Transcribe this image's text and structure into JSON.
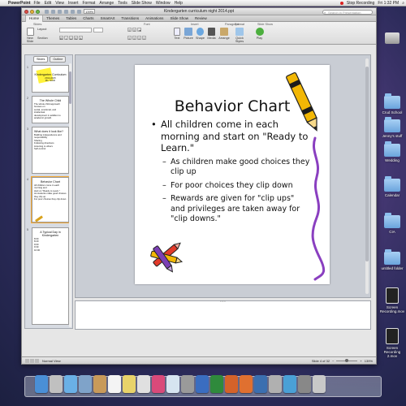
{
  "menubar": {
    "app_name": "PowerPoint",
    "items": [
      "File",
      "Edit",
      "View",
      "Insert",
      "Format",
      "Arrange",
      "Tools",
      "Slide Show",
      "Window",
      "Help"
    ],
    "recording_label": "Stop Recording",
    "clock": "Fri 1:32 PM"
  },
  "window": {
    "title": "Kindergarten curriculum night 2014.ppt",
    "zoom": "139%",
    "search_placeholder": "Search in Presentation"
  },
  "ribbon": {
    "tabs": [
      "Home",
      "Themes",
      "Tables",
      "Charts",
      "SmartArt",
      "Transitions",
      "Animations",
      "Slide Show",
      "Review"
    ],
    "active_tab": "Home",
    "groups": [
      "Slides",
      "Font",
      "Paragraph",
      "Insert",
      "Format",
      "Slide Show"
    ],
    "slides_buttons": [
      "New Slide",
      "Layout",
      "Section"
    ],
    "insert_buttons": [
      "Text",
      "Picture",
      "Shape",
      "Media",
      "Arrange",
      "Quick Styles",
      "Play"
    ]
  },
  "pane": {
    "tabs": [
      "Slides",
      "Outline"
    ],
    "thumbnails": [
      {
        "num": "1",
        "title": "Kindergarten Curriculum",
        "lines": [
          "2014-2015",
          "Ms. Smith"
        ]
      },
      {
        "num": "2",
        "title": "The Whole Child",
        "lines": [
          "The whole child approach focuses on",
          "social, emotional, and intellectual",
          "development in addition to academic growth."
        ]
      },
      {
        "num": "3",
        "title": "What does it look like?",
        "lines": [
          "Building independence and responsibility",
          "Sharing",
          "Following directions",
          "Listening to others",
          "Self-control"
        ]
      },
      {
        "num": "4",
        "title": "Behavior Chart",
        "lines": [
          "All children come in each morning and",
          "start on \"Ready to Learn.\"",
          "As students make good choices they clip up",
          "For poor choices they clip down"
        ]
      },
      {
        "num": "5",
        "title": "A Typical Day in Kindergarten",
        "lines": [
          "8:00",
          "8:20",
          "9:00",
          "9:30",
          "10:00"
        ]
      }
    ]
  },
  "slide": {
    "title": "Behavior Chart",
    "bullet": "All children come in each morning and start on \"Ready to Learn.\"",
    "subbullets": [
      "As children make good choices they clip up",
      "For poor choices they clip down",
      "Rewards are given for \"clip ups\" and privileges are taken away for \"clip downs.\""
    ]
  },
  "statusbar": {
    "view": "Normal View",
    "slide_position": "Slide 4 of 32",
    "zoom": "139%"
  },
  "desktop": {
    "icons": [
      {
        "label": "Crud School"
      },
      {
        "label": "Jenny's stuff"
      },
      {
        "label": "Wedding"
      },
      {
        "label": "Calendar"
      },
      {
        "label": "CIA"
      },
      {
        "label": "untitled folder"
      },
      {
        "label": "Screen Recording.mov"
      },
      {
        "label": "Screen Recording 2.mov"
      }
    ]
  },
  "colors": {
    "selection": "#f4a834",
    "desktop_bg": "#4a3a78",
    "slide_bg": "#ffffff"
  }
}
